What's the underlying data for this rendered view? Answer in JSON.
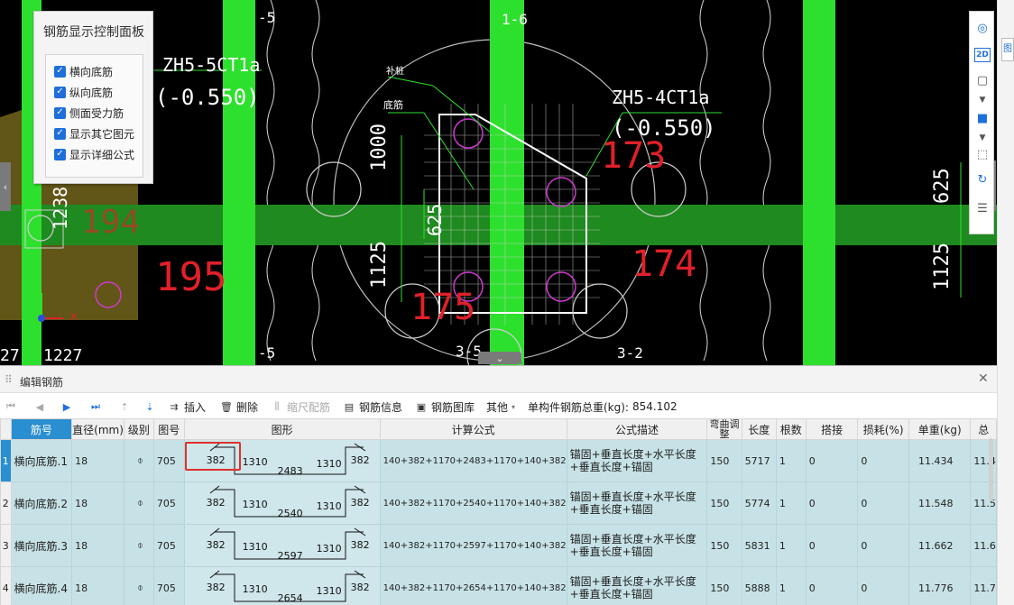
{
  "cad": {
    "colors": {
      "background": "#000000",
      "green_bar": "#2ee02e",
      "green_band": "#1f8a1f",
      "red_text": "#e0202a",
      "white_text": "#ffffff",
      "olive": "#6b5e1a",
      "magenta": "#d03ad0"
    },
    "labels": {
      "axis_top_a": "-5",
      "axis_top_b": "1-6",
      "axis_bottom_a": "-5",
      "axis_bottom_b": "3-2",
      "axis_bottom_c": "3-5",
      "zh_left": "ZH5-5CT1a",
      "zh_left_elev": "(-0.550)",
      "zh_right": "ZH5-4CT1a",
      "zh_right_elev": "(-0.550)",
      "dim_1000": "1000",
      "dim_625": "625",
      "dim_1125": "1125",
      "dim_1238": "1238",
      "dim_625_right": "625",
      "dim_1125_right": "1125",
      "red_195": "195",
      "red_174": "174",
      "red_175": "175",
      "red_173": "173",
      "red_194": "194",
      "bottom_227": "27",
      "bottom_1227": "1227",
      "note_a": "补桩",
      "note_b": "底筋",
      "axis_x": "X"
    }
  },
  "control_panel": {
    "title": "钢筋显示控制面板",
    "options": [
      {
        "label": "横向底筋",
        "checked": true
      },
      {
        "label": "纵向底筋",
        "checked": true
      },
      {
        "label": "侧面受力筋",
        "checked": true
      },
      {
        "label": "显示其它图元",
        "checked": true
      },
      {
        "label": "显示详细公式",
        "checked": true
      }
    ]
  },
  "right_toolbar": {
    "icons": [
      "globe-icon",
      "2d-view-icon",
      "3d-box-icon",
      "dropdown-arrow-icon",
      "cube-icon",
      "dropdown-arrow-icon",
      "select-frame-icon",
      "rotate-icon",
      "list-icon"
    ],
    "label_2d": "2D"
  },
  "far_right": {
    "tab_label": "图"
  },
  "editor": {
    "title": "编辑钢筋",
    "toolbar": {
      "insert": "插入",
      "delete": "删除",
      "scale_rebar": "缩尺配筋",
      "rebar_info": "钢筋信息",
      "rebar_library": "钢筋图库",
      "other": "其他",
      "total_weight_label": "单构件钢筋总重(kg):",
      "total_weight_value": "854.102"
    },
    "columns": [
      "筋号",
      "直径(mm)",
      "级别",
      "图号",
      "图形",
      "计算公式",
      "公式描述",
      "弯曲调整",
      "长度",
      "根数",
      "搭接",
      "损耗(%)",
      "单重(kg)",
      "总"
    ],
    "rows": [
      {
        "row_no": "1",
        "name": "横向底筋.1",
        "diameter": "18",
        "grade": "⌽",
        "figure_no": "705",
        "shape": {
          "hook_left": "382",
          "left": "1310",
          "mid": "2483",
          "right": "1310",
          "hook_right": "382"
        },
        "formula": "140+382+1170+2483+1170+140+382",
        "desc": "锚固+垂直长度+水平长度+垂直长度+锚固",
        "bend": "150",
        "length": "5717",
        "count": "1",
        "lap": "0",
        "loss": "0",
        "unit_weight": "11.434",
        "total": "11.4"
      },
      {
        "row_no": "2",
        "name": "横向底筋.2",
        "diameter": "18",
        "grade": "⌽",
        "figure_no": "705",
        "shape": {
          "hook_left": "382",
          "left": "1310",
          "mid": "2540",
          "right": "1310",
          "hook_right": "382"
        },
        "formula": "140+382+1170+2540+1170+140+382",
        "desc": "锚固+垂直长度+水平长度+垂直长度+锚固",
        "bend": "150",
        "length": "5774",
        "count": "1",
        "lap": "0",
        "loss": "0",
        "unit_weight": "11.548",
        "total": "11.5"
      },
      {
        "row_no": "3",
        "name": "横向底筋.3",
        "diameter": "18",
        "grade": "⌽",
        "figure_no": "705",
        "shape": {
          "hook_left": "382",
          "left": "1310",
          "mid": "2597",
          "right": "1310",
          "hook_right": "382"
        },
        "formula": "140+382+1170+2597+1170+140+382",
        "desc": "锚固+垂直长度+水平长度+垂直长度+锚固",
        "bend": "150",
        "length": "5831",
        "count": "1",
        "lap": "0",
        "loss": "0",
        "unit_weight": "11.662",
        "total": "11.6"
      },
      {
        "row_no": "4",
        "name": "横向底筋.4",
        "diameter": "18",
        "grade": "⌽",
        "figure_no": "705",
        "shape": {
          "hook_left": "382",
          "left": "1310",
          "mid": "2654",
          "right": "1310",
          "hook_right": "382"
        },
        "formula": "140+382+1170+2654+1170+140+382",
        "desc": "锚固+垂直长度+水平长度+垂直长度+锚固",
        "bend": "150",
        "length": "5888",
        "count": "1",
        "lap": "0",
        "loss": "0",
        "unit_weight": "11.776",
        "total": "11.7"
      }
    ]
  }
}
